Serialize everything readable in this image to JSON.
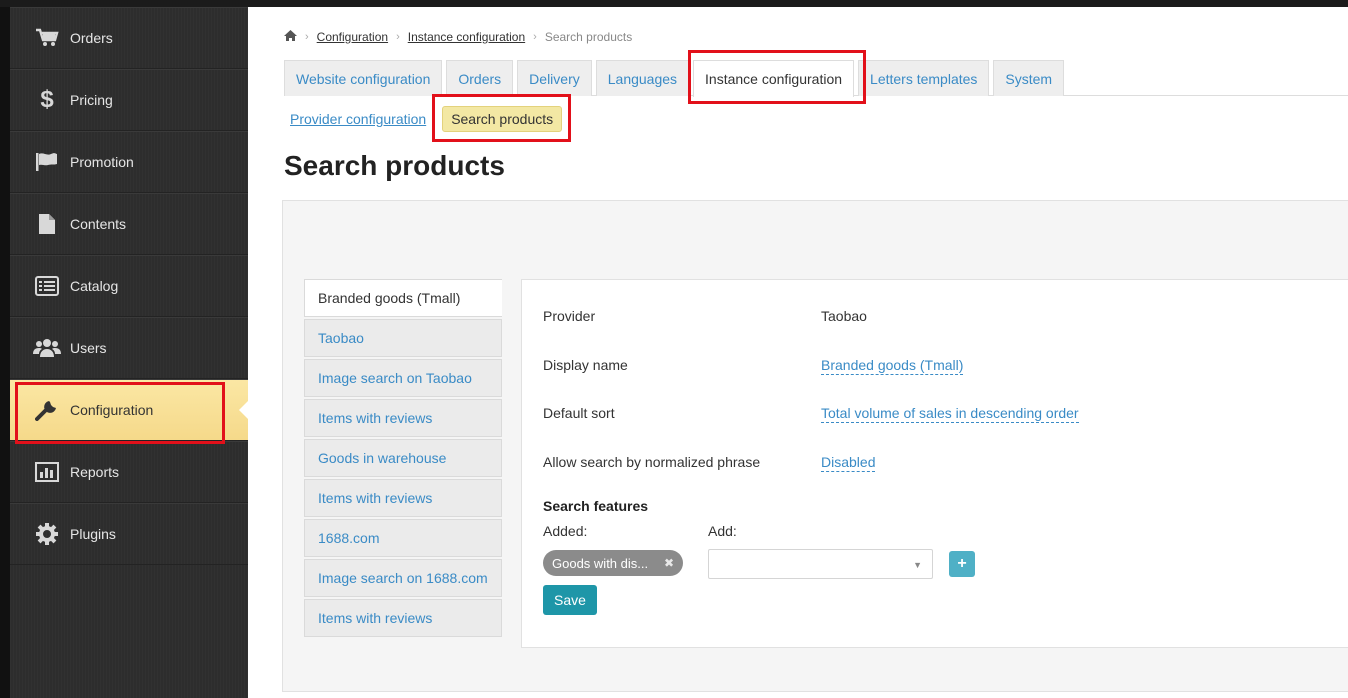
{
  "sidebar": {
    "items": [
      {
        "label": "Orders",
        "icon": "cart-icon"
      },
      {
        "label": "Pricing",
        "icon": "dollar-icon"
      },
      {
        "label": "Promotion",
        "icon": "flag-icon"
      },
      {
        "label": "Contents",
        "icon": "document-icon"
      },
      {
        "label": "Catalog",
        "icon": "list-icon"
      },
      {
        "label": "Users",
        "icon": "users-icon"
      },
      {
        "label": "Configuration",
        "icon": "wrench-icon"
      },
      {
        "label": "Reports",
        "icon": "chart-icon"
      },
      {
        "label": "Plugins",
        "icon": "gear-icon"
      }
    ]
  },
  "breadcrumb": {
    "items": [
      "Configuration",
      "Instance configuration"
    ],
    "current": "Search products"
  },
  "tabs": [
    "Website configuration",
    "Orders",
    "Delivery",
    "Languages",
    "Instance configuration",
    "Letters templates",
    "System"
  ],
  "subtabs": {
    "link": "Provider configuration",
    "active": "Search products"
  },
  "page": {
    "title": "Search products"
  },
  "vtabs": [
    "Branded goods (Tmall)",
    "Taobao",
    "Image search on Taobao",
    "Items with reviews",
    "Goods in warehouse",
    "Items with reviews",
    "1688.com",
    "Image search on 1688.com",
    "Items with reviews"
  ],
  "form": {
    "provider_label": "Provider",
    "provider_value": "Taobao",
    "display_name_label": "Display name",
    "display_name_value": "Branded goods (Tmall)",
    "default_sort_label": "Default sort",
    "default_sort_value": "Total volume of sales in descending order",
    "normalized_label": "Allow search by normalized phrase",
    "normalized_value": "Disabled",
    "search_features_title": "Search features",
    "added_label": "Added:",
    "add_label": "Add:",
    "chip_text": "Goods with dis...",
    "plus_label": "+",
    "save_label": "Save"
  },
  "colors": {
    "accent_link": "#3a8bc6",
    "highlight": "#e2101a",
    "active_menu": "#f5d98a",
    "save_button": "#1e96a8"
  }
}
